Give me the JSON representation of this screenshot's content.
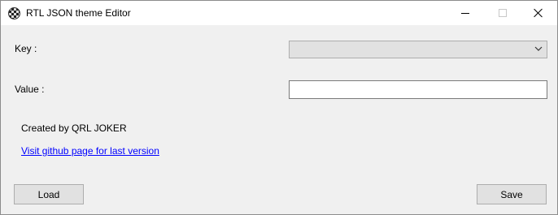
{
  "window": {
    "title": "RTL JSON theme Editor",
    "app_icon": "checkered-globe-icon"
  },
  "form": {
    "key_label": "Key :",
    "key_value": "",
    "value_label": "Value :",
    "value_text": ""
  },
  "info": {
    "created_by": "Created by QRL JOKER",
    "link_text": "Visit github page for last version"
  },
  "buttons": {
    "load": "Load",
    "save": "Save"
  },
  "colors": {
    "background": "#f0f0f0",
    "link": "#0000ff",
    "button": "#e1e1e1"
  }
}
